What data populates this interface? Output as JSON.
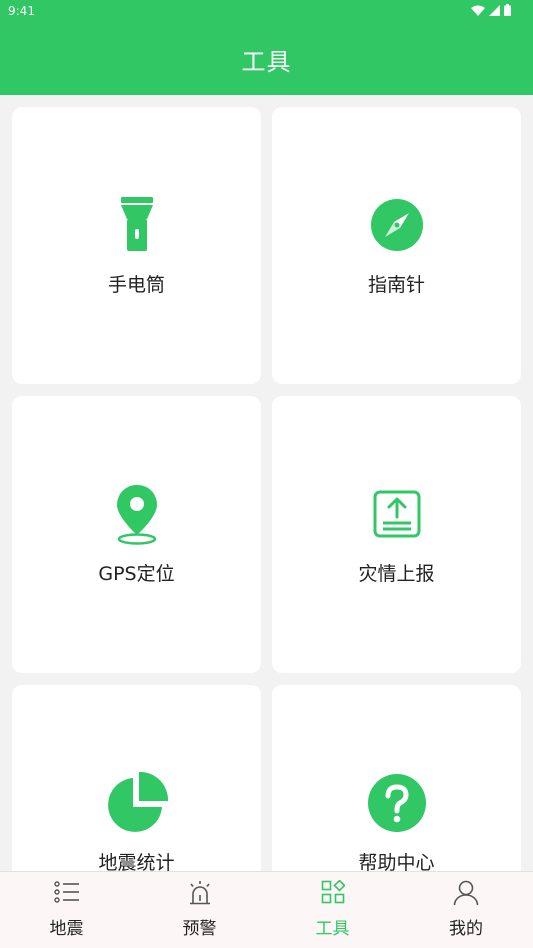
{
  "status_bar": {
    "time": "9:41"
  },
  "header": {
    "title": "工具"
  },
  "tools": [
    {
      "label": "手电筒",
      "icon": "flashlight-icon"
    },
    {
      "label": "指南针",
      "icon": "compass-icon"
    },
    {
      "label": "GPS定位",
      "icon": "location-pin-icon"
    },
    {
      "label": "灾情上报",
      "icon": "upload-report-icon"
    },
    {
      "label": "地震统计",
      "icon": "pie-chart-icon"
    },
    {
      "label": "帮助中心",
      "icon": "help-icon"
    }
  ],
  "tabbar": {
    "active": 2,
    "items": [
      {
        "label": "地震",
        "icon": "list-icon"
      },
      {
        "label": "预警",
        "icon": "alarm-icon"
      },
      {
        "label": "工具",
        "icon": "apps-icon"
      },
      {
        "label": "我的",
        "icon": "user-icon"
      }
    ]
  },
  "colors": {
    "accent": "#30c764",
    "background": "#f2f2f2",
    "card": "#ffffff",
    "tab_inactive": "#555555"
  }
}
